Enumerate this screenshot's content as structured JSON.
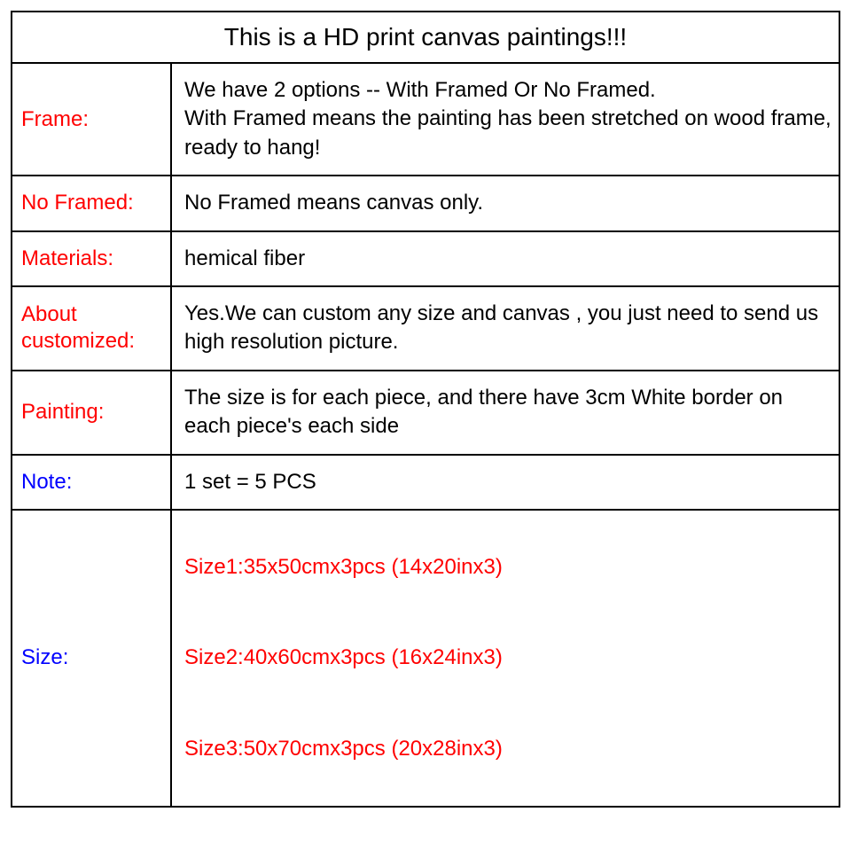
{
  "title": "This is a HD print canvas paintings!!!",
  "rows": {
    "frame": {
      "label": "Frame:",
      "value": "We have 2 options -- With Framed Or No Framed.\nWith Framed means the painting has been stretched on wood frame, ready to hang!"
    },
    "noFramed": {
      "label": "No Framed:",
      "value": "No Framed means canvas only."
    },
    "materials": {
      "label": "Materials:",
      "value": "hemical fiber"
    },
    "customized": {
      "label": "About customized:",
      "value": "Yes.We can custom any size and  canvas ,  you just need to send us high resolution picture."
    },
    "painting": {
      "label": "Painting:",
      "value": "The size is for each piece, and there have 3cm White border on each piece's each side"
    },
    "note": {
      "label": "Note:",
      "value": "1 set = 5 PCS"
    },
    "size": {
      "label": "Size:",
      "size1": "Size1:35x50cmx3pcs (14x20inx3)",
      "size2": "Size2:40x60cmx3pcs (16x24inx3)",
      "size3": "Size3:50x70cmx3pcs (20x28inx3)"
    }
  }
}
